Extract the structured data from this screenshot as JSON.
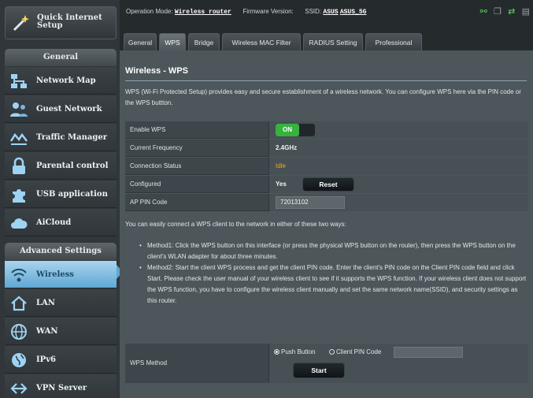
{
  "sidebar": {
    "quick_setup": "Quick Internet Setup",
    "general_header": "General",
    "general_items": [
      {
        "label": "Network Map",
        "icon": "network-map-icon"
      },
      {
        "label": "Guest Network",
        "icon": "guest-network-icon"
      },
      {
        "label": "Traffic Manager",
        "icon": "traffic-manager-icon"
      },
      {
        "label": "Parental control",
        "icon": "lock-icon"
      },
      {
        "label": "USB application",
        "icon": "puzzle-icon"
      },
      {
        "label": "AiCloud",
        "icon": "cloud-icon"
      }
    ],
    "advanced_header": "Advanced Settings",
    "advanced_items": [
      {
        "label": "Wireless",
        "icon": "wireless-icon",
        "active": true
      },
      {
        "label": "LAN",
        "icon": "home-icon"
      },
      {
        "label": "WAN",
        "icon": "globe-icon"
      },
      {
        "label": "IPv6",
        "icon": "ipv6-globe-icon"
      },
      {
        "label": "VPN Server",
        "icon": "vpn-icon"
      }
    ]
  },
  "header": {
    "op_mode_label": "Operation Mode:",
    "op_mode_value": "Wireless router",
    "firmware_label": "Firmware Version:",
    "ssid_label": "SSID:",
    "ssid_1": "ASUS",
    "ssid_2": "ASUS_5G"
  },
  "tabs": [
    "General",
    "WPS",
    "Bridge",
    "Wireless MAC Filter",
    "RADIUS Setting",
    "Professional"
  ],
  "active_tab": "WPS",
  "page": {
    "title": "Wireless - WPS",
    "description": "WPS (Wi-Fi Protected Setup) provides easy and secure establishment of a wireless network. You can configure WPS here via the PIN code or the WPS buttton.",
    "rows": {
      "enable_wps_label": "Enable WPS",
      "enable_wps_value": "ON",
      "frequency_label": "Current Frequency",
      "frequency_value": "2.4GHz",
      "status_label": "Connection Status",
      "status_value": "Idle",
      "configured_label": "Configured",
      "configured_value": "Yes",
      "reset_label": "Reset",
      "pin_label": "AP PIN Code",
      "pin_value": "72013102"
    },
    "intro": "You can easily connect a WPS client to the network in either of these two ways:",
    "method1": "Method1: Click the WPS button on this interface (or press the physical WPS button on the router), then press the WPS button on the client's WLAN adapter for about three minutes.",
    "method2": "Method2: Start the client WPS process and get the client PIN code. Enter the client's PIN code on the Client PIN code field and click Start. Please check the user manual of your wireless client to see if it supports the WPS function. If your wireless client does not support the WPS function, you have to configure the wireless client manually and set the same network name(SSID), and security settings as this router.",
    "method_label": "WPS Method",
    "push_button": "Push Button",
    "client_pin": "Client PIN Code",
    "start": "Start"
  },
  "colors": {
    "accent": "#5fa7d3",
    "on_green": "#37b23f",
    "idle_orange": "#ffa800"
  }
}
